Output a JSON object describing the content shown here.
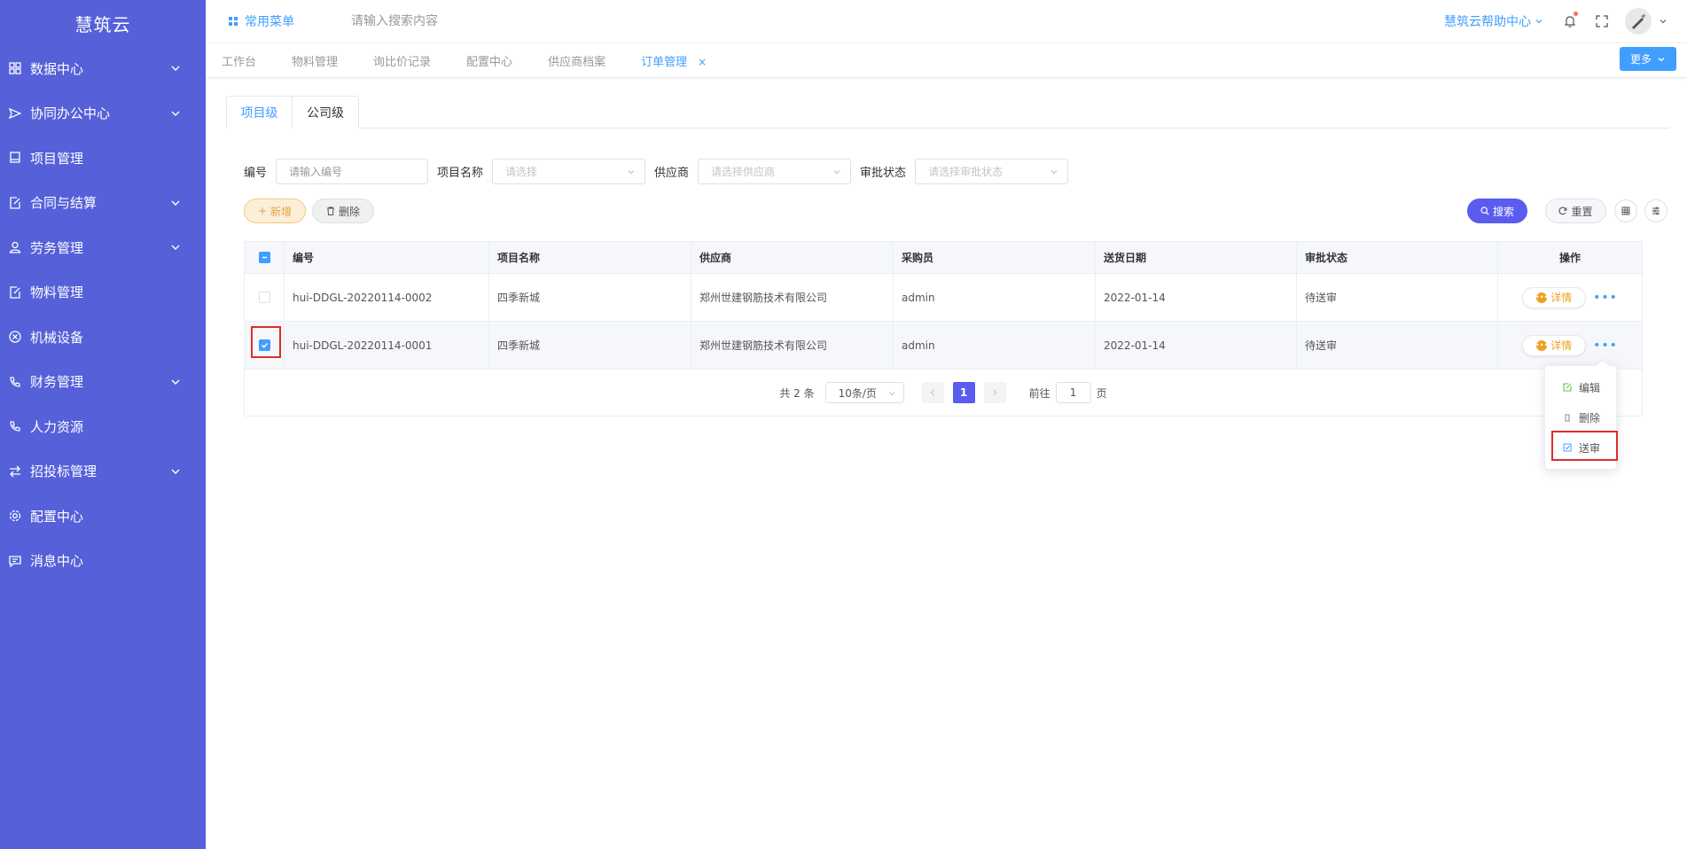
{
  "sidebar": {
    "logo": "慧筑云",
    "items": [
      {
        "label": "数据中心"
      },
      {
        "label": "协同办公中心"
      },
      {
        "label": "项目管理"
      },
      {
        "label": "合同与结算"
      },
      {
        "label": "劳务管理"
      },
      {
        "label": "物料管理"
      },
      {
        "label": "机械设备"
      },
      {
        "label": "财务管理"
      },
      {
        "label": "人力资源"
      },
      {
        "label": "招投标管理"
      },
      {
        "label": "配置中心"
      },
      {
        "label": "消息中心"
      }
    ]
  },
  "header": {
    "quick_menu": "常用菜单",
    "search_placeholder": "请输入搜索内容",
    "help": "慧筑云帮助中心"
  },
  "tags": {
    "items": [
      "工作台",
      "物料管理",
      "询比价记录",
      "配置中心",
      "供应商档案",
      "订单管理"
    ],
    "close": "×",
    "more": "更多"
  },
  "tabs": [
    "项目级",
    "公司级"
  ],
  "filters": {
    "code_label": "编号",
    "code_placeholder": "请输入编号",
    "project_label": "项目名称",
    "project_placeholder": "请选择",
    "supplier_label": "供应商",
    "supplier_placeholder": "请选择供应商",
    "status_label": "审批状态",
    "status_placeholder": "请选择审批状态"
  },
  "toolbar": {
    "add": "新增",
    "delete": "删除",
    "search": "搜索",
    "reset": "重置"
  },
  "table": {
    "headers": [
      "编号",
      "项目名称",
      "供应商",
      "采购员",
      "送货日期",
      "审批状态",
      "操作"
    ],
    "rows": [
      {
        "code": "hui-DDGL-20220114-0002",
        "project": "四季新城",
        "supplier": "郑州世建钢筋技术有限公司",
        "buyer": "admin",
        "date": "2022-01-14",
        "status": "待送审",
        "selected": false
      },
      {
        "code": "hui-DDGL-20220114-0001",
        "project": "四季新城",
        "supplier": "郑州世建钢筋技术有限公司",
        "buyer": "admin",
        "date": "2022-01-14",
        "status": "待送审",
        "selected": true
      }
    ],
    "detail": "详情"
  },
  "pager": {
    "total": "共 2 条",
    "page_size": "10条/页",
    "current": "1",
    "goto_prefix": "前往",
    "goto_value": "1",
    "goto_suffix": "页"
  },
  "dropdown": {
    "edit": "编辑",
    "delete": "删除",
    "submit": "送审"
  },
  "colors": {
    "sidebar": "#5560d9",
    "primary": "#409eff",
    "search_btn": "#5a5cf0",
    "warning": "#f0a020",
    "highlight_box": "#e02b2b"
  }
}
